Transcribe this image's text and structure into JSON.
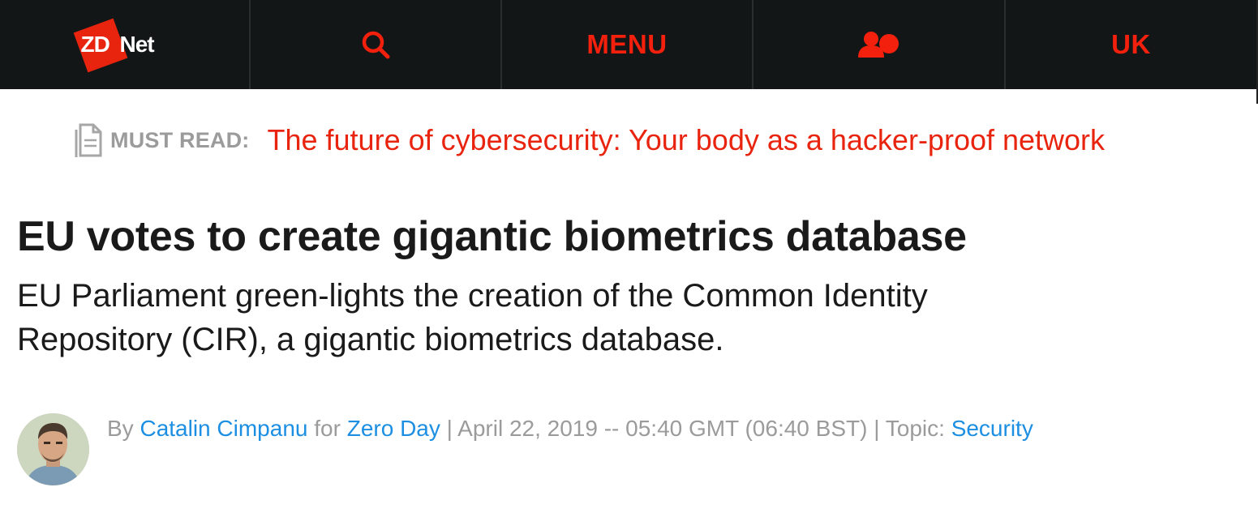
{
  "nav": {
    "logo": {
      "zd": "ZD",
      "net": "Net"
    },
    "search_icon": "search-icon",
    "menu_label": "MENU",
    "user_icon": "user-group-icon",
    "edition_label": "UK"
  },
  "must_read": {
    "icon": "document-icon",
    "label": "MUST READ:",
    "link_text": "The future of cybersecurity: Your body as a hacker-proof network"
  },
  "article": {
    "headline": "EU votes to create gigantic biometrics database",
    "summary": "EU Parliament green-lights the creation of the Common Identity Repository (CIR), a gigantic biometrics database."
  },
  "byline": {
    "by": "By",
    "author": "Catalin Cimpanu",
    "for": "for",
    "blog": "Zero Day",
    "date": "| April 22, 2019 -- 05:40 GMT (06:40 BST) | Topic:",
    "topic": "Security"
  },
  "colors": {
    "nav_bg": "#131617",
    "accent": "#e8240f",
    "link_blue": "#1d8fe2",
    "muted": "#9b9b9b"
  }
}
